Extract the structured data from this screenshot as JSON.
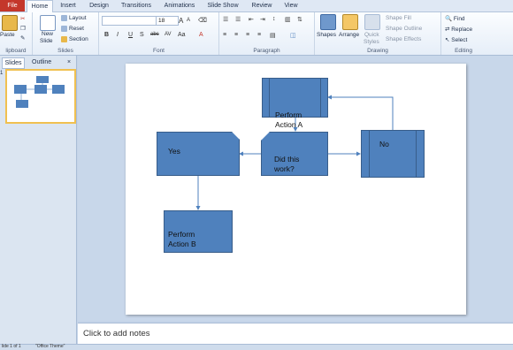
{
  "tabs": [
    {
      "label": "File"
    },
    {
      "label": "Home"
    },
    {
      "label": "Insert"
    },
    {
      "label": "Design"
    },
    {
      "label": "Transitions"
    },
    {
      "label": "Animations"
    },
    {
      "label": "Slide Show"
    },
    {
      "label": "Review"
    },
    {
      "label": "View"
    }
  ],
  "ribbon": {
    "clipboard": {
      "paste": "Paste",
      "label": "lipboard"
    },
    "slides": {
      "new_slide": "New",
      "new_slide2": "Slide",
      "layout": "Layout",
      "reset": "Reset",
      "section": "Section",
      "label": "Slides"
    },
    "font": {
      "size": "18",
      "label": "Font",
      "bold": "B",
      "italic": "I",
      "underline": "U",
      "strike": "S",
      "shadow": "abc",
      "spacing": "AV",
      "case": "Aa",
      "grow": "A",
      "shrink": "A"
    },
    "paragraph": {
      "label": "Paragraph"
    },
    "drawing": {
      "shapes": "Shapes",
      "arrange": "Arrange",
      "quick": "Quick",
      "styles": "Styles",
      "fill": "Shape Fill",
      "outline": "Shape Outline",
      "effects": "Shape Effects",
      "label": "Drawing"
    },
    "editing": {
      "find": "Find",
      "replace": "Replace",
      "select": "Select",
      "label": "Editing"
    }
  },
  "panel": {
    "slides_tab": "Slides",
    "outline_tab": "Outline",
    "close": "×",
    "slide_number": "1"
  },
  "diagram": {
    "action_a": "Perform\nAction A",
    "question": "Did this\nwork?",
    "yes": "Yes",
    "no": "No",
    "action_b": "Perform\nAction B"
  },
  "notes": {
    "placeholder": "Click to add notes"
  },
  "status": {
    "slide_info": "lide 1 of 1",
    "theme": "\"Office Theme\""
  }
}
